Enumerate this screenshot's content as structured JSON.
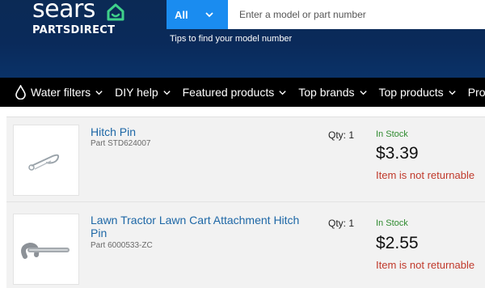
{
  "brand": {
    "wordmark": "sears",
    "subline": "PARTSDIRECT"
  },
  "search": {
    "category": "All",
    "placeholder": "Enter a model or part number",
    "tips": "Tips to find your model number",
    "accent": "#1a8cf0"
  },
  "nav": {
    "items": [
      {
        "label": "Water filters",
        "icon": "water-drop-icon"
      },
      {
        "label": "DIY help"
      },
      {
        "label": "Featured products"
      },
      {
        "label": "Top brands"
      },
      {
        "label": "Top products"
      },
      {
        "label": "Products by"
      }
    ]
  },
  "products": [
    {
      "title": "Hitch Pin",
      "part": "Part STD624007",
      "qty": "Qty: 1",
      "stock": "In Stock",
      "price": "$3.39",
      "returnable": "Item is not returnable"
    },
    {
      "title": "Lawn Tractor Lawn Cart Attachment Hitch Pin",
      "part": "Part 6000533-ZC",
      "qty": "Qty: 1",
      "stock": "In Stock",
      "price": "$2.55",
      "returnable": "Item is not returnable"
    }
  ],
  "colors": {
    "header": "#0b2a55",
    "link": "#1d67a6",
    "in_stock": "#2f8a2f",
    "not_returnable": "#c0392b"
  }
}
